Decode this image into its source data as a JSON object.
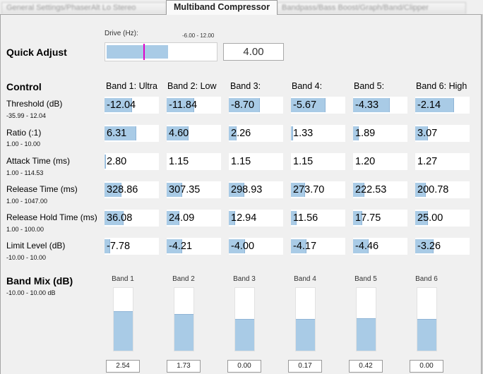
{
  "tabs": [
    {
      "label": "General Settings/PhaserAlt Lo Stereo"
    },
    {
      "label": "Multiband Compressor"
    },
    {
      "label": "Bandpass/Bass Boost/Graph/Band/Clipper"
    }
  ],
  "quick_adjust": {
    "title": "Quick Adjust",
    "drive_label": "Drive (Hz):",
    "drive_range": "-6.00 - 12.00",
    "drive_value": "4.00",
    "drive_fraction": 0.333,
    "fill_fraction": 0.555
  },
  "control": {
    "title": "Control",
    "bands": [
      "Band 1: Ultra",
      "Band 2: Low",
      "Band 3:",
      "Band 4:",
      "Band 5:",
      "Band 6: High"
    ],
    "rows": [
      {
        "label": "Threshold (dB)",
        "range": "-35.99 - 12.04",
        "values": [
          "-12.04",
          "-11.84",
          "-8.70",
          "-5.67",
          "-4.33",
          "-2.14"
        ],
        "fill": [
          0.5,
          0.5,
          0.57,
          0.64,
          0.67,
          0.72
        ]
      },
      {
        "label": "Ratio (:1)",
        "range": "1.00 - 10.00",
        "values": [
          "6.31",
          "4.60",
          "2.26",
          "1.33",
          "1.89",
          "3.07"
        ],
        "fill": [
          0.59,
          0.4,
          0.14,
          0.04,
          0.1,
          0.23
        ]
      },
      {
        "label": "Attack Time (ms)",
        "range": "1.00 - 114.53",
        "values": [
          "2.80",
          "1.15",
          "1.15",
          "1.15",
          "1.20",
          "1.27"
        ],
        "fill": [
          0.02,
          0.0,
          0.0,
          0.0,
          0.0,
          0.0
        ]
      },
      {
        "label": "Release Time (ms)",
        "range": "1.00 - 1047.00",
        "values": [
          "328.86",
          "307.35",
          "298.93",
          "273.70",
          "222.53",
          "200.78"
        ],
        "fill": [
          0.31,
          0.29,
          0.28,
          0.26,
          0.21,
          0.19
        ]
      },
      {
        "label": "Release Hold Time (ms)",
        "range": "1.00 - 100.00",
        "values": [
          "36.08",
          "24.09",
          "12.94",
          "11.56",
          "17.75",
          "25.00"
        ],
        "fill": [
          0.35,
          0.23,
          0.12,
          0.11,
          0.17,
          0.24
        ]
      },
      {
        "label": "Limit Level (dB)",
        "range": "-10.00 - 10.00",
        "values": [
          "-7.78",
          "-4.21",
          "-4.00",
          "-4.17",
          "-4.46",
          "-3.26"
        ],
        "fill": [
          0.11,
          0.29,
          0.3,
          0.29,
          0.28,
          0.34
        ]
      }
    ]
  },
  "band_mix": {
    "title": "Band Mix (dB)",
    "range": "-10.00 - 10.00 dB",
    "bands": [
      {
        "label": "Band 1",
        "value": "2.54",
        "level": 0.63
      },
      {
        "label": "Band 2",
        "value": "1.73",
        "level": 0.58
      },
      {
        "label": "Band 3",
        "value": "0.00",
        "level": 0.5
      },
      {
        "label": "Band 4",
        "value": "0.17",
        "level": 0.51
      },
      {
        "label": "Band 5",
        "value": "0.42",
        "level": 0.52
      },
      {
        "label": "Band 6",
        "value": "0.00",
        "level": 0.5
      }
    ]
  },
  "colors": {
    "fill": "#a9cbe6",
    "marker": "#e000c8"
  }
}
